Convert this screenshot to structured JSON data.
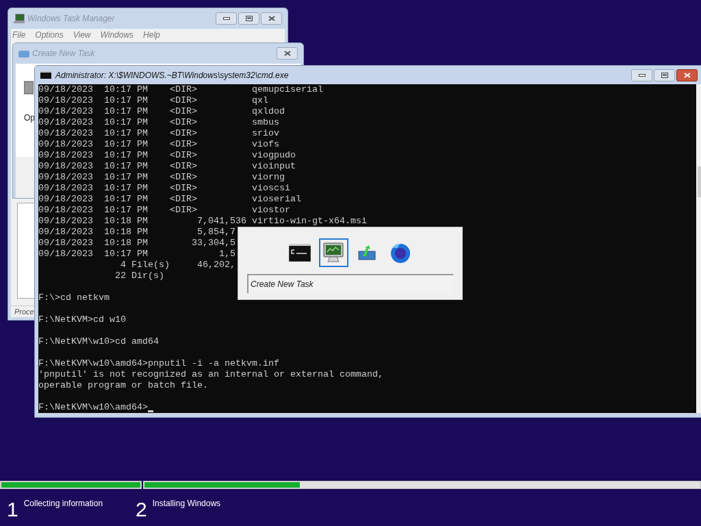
{
  "task_manager": {
    "title": "Windows Task Manager",
    "menu": [
      "File",
      "Options",
      "View",
      "Windows",
      "Help"
    ],
    "status_text": "Proce"
  },
  "run_dialog": {
    "title": "Create New Task",
    "label": "Op"
  },
  "console": {
    "title": "Administrator: X:\\$WINDOWS.~BT\\Windows\\system32\\cmd.exe",
    "blocks": [
      [
        "09/18/2023  10:17 PM    <DIR>          qemupciserial",
        "09/18/2023  10:17 PM    <DIR>          qxl",
        "09/18/2023  10:17 PM    <DIR>          qxldod",
        "09/18/2023  10:17 PM    <DIR>          smbus",
        "09/18/2023  10:17 PM    <DIR>          sriov",
        "09/18/2023  10:17 PM    <DIR>          viofs",
        "09/18/2023  10:17 PM    <DIR>          viogpudo",
        "09/18/2023  10:17 PM    <DIR>          vioinput",
        "09/18/2023  10:17 PM    <DIR>          viorng",
        "09/18/2023  10:17 PM    <DIR>          vioscsi",
        "09/18/2023  10:17 PM    <DIR>          vioserial",
        "09/18/2023  10:17 PM    <DIR>          viostor",
        "09/18/2023  10:18 PM         7,041,536 virtio-win-gt-x64.msi",
        "09/18/2023  10:18 PM         5,854,7",
        "09/18/2023  10:18 PM        33,304,5",
        "09/18/2023  10:17 PM             1,5",
        "               4 File(s)     46,202,",
        "              22 Dir(s)"
      ],
      [
        "F:\\>cd netkvm"
      ],
      [
        "F:\\NetKVM>cd w10"
      ],
      [
        "F:\\NetKVM\\w10>cd amd64"
      ],
      [
        "F:\\NetKVM\\w10\\amd64>pnputil -i -a netkvm.inf",
        "'pnputil' is not recognized as an internal or external command,",
        "operable program or batch file."
      ],
      [
        "F:\\NetKVM\\w10\\amd64>"
      ]
    ]
  },
  "switcher": {
    "items": [
      {
        "kind": "console",
        "selected": false
      },
      {
        "kind": "monitor",
        "selected": true
      },
      {
        "kind": "setup",
        "selected": false
      },
      {
        "kind": "browser",
        "selected": false
      }
    ],
    "caption": "Create New Task"
  },
  "setup": {
    "progress": [
      {
        "level": 1
      },
      {
        "level": 0.28
      }
    ],
    "steps": [
      {
        "number": "1",
        "label": "Collecting information"
      },
      {
        "number": "2",
        "label": "Installing Windows"
      }
    ]
  }
}
